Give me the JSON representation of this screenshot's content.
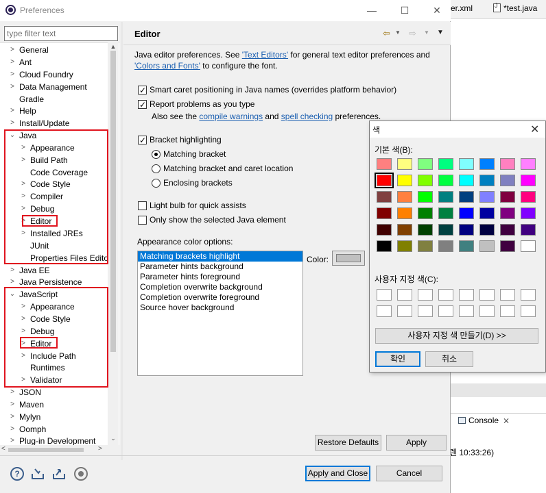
{
  "ide": {
    "tab_xml": "er.xml",
    "tab_java": "*test.java",
    "console_tab": "Console",
    "console_close": "⨯",
    "console_time": "렌 10:33:26)"
  },
  "window": {
    "title": "Preferences",
    "minimize": "—",
    "maximize": "☐",
    "close": "✕"
  },
  "filter": {
    "placeholder": "type filter text"
  },
  "tree": {
    "general": "General",
    "ant": "Ant",
    "cloud_foundry": "Cloud Foundry",
    "data_management": "Data Management",
    "gradle": "Gradle",
    "help": "Help",
    "install_update": "Install/Update",
    "java": "Java",
    "java_appearance": "Appearance",
    "java_build_path": "Build Path",
    "java_code_coverage": "Code Coverage",
    "java_code_style": "Code Style",
    "java_compiler": "Compiler",
    "java_debug": "Debug",
    "java_editor": "Editor",
    "java_installed_jres": "Installed JREs",
    "java_junit": "JUnit",
    "java_properties_files_editor": "Properties Files Edito",
    "java_ee": "Java EE",
    "java_persistence": "Java Persistence",
    "javascript": "JavaScript",
    "js_appearance": "Appearance",
    "js_code_style": "Code Style",
    "js_debug": "Debug",
    "js_editor": "Editor",
    "js_include_path": "Include Path",
    "js_runtimes": "Runtimes",
    "js_validator": "Validator",
    "json": "JSON",
    "maven": "Maven",
    "mylyn": "Mylyn",
    "oomph": "Oomph",
    "plugin_development": "Plug-in Development"
  },
  "editor": {
    "title": "Editor",
    "intro_1": "Java editor preferences. See ",
    "intro_link1": "'Text Editors'",
    "intro_2": " for general text editor preferences and ",
    "intro_link2": "'Colors and Fonts'",
    "intro_3": " to configure the font.",
    "smart_caret": "Smart caret positioning in Java names (overrides platform behavior)",
    "report_problems": "Report problems as you type",
    "see_also_1": "Also see the ",
    "see_also_link1": "compile warnings",
    "see_also_2": " and ",
    "see_also_link2": "spell checking",
    "see_also_3": " preferences.",
    "bracket_highlighting": "Bracket highlighting",
    "matching_bracket": "Matching bracket",
    "matching_bracket_caret": "Matching bracket and caret location",
    "enclosing_brackets": "Enclosing brackets",
    "light_bulb": "Light bulb for quick assists",
    "only_selected": "Only show the selected Java element",
    "appearance_options_label": "Appearance color options:",
    "color_options": [
      "Matching brackets highlight",
      "Parameter hints background",
      "Parameter hints foreground",
      "Completion overwrite background",
      "Completion overwrite foreground",
      "Source hover background"
    ],
    "color_label": "Color:",
    "color_value": "#c0c0c0"
  },
  "buttons": {
    "restore_defaults": "Restore Defaults",
    "apply": "Apply",
    "apply_and_close": "Apply and Close",
    "cancel": "Cancel",
    "help_symbol": "?"
  },
  "color_dialog": {
    "title": "색",
    "close": "✕",
    "basic_colors_label": "기본 색(B):",
    "custom_colors_label": "사용자 지정 색(C):",
    "define_custom": "사용자 지정 색 만들기(D) >>",
    "ok": "확인",
    "cancel": "취소",
    "basic_colors": [
      [
        "#ff8080",
        "#ffff80",
        "#80ff80",
        "#00ff80",
        "#80ffff",
        "#0080ff",
        "#ff80c0",
        "#ff80ff"
      ],
      [
        "#ff0000",
        "#ffff00",
        "#80ff00",
        "#00ff40",
        "#00ffff",
        "#0080c0",
        "#8080c0",
        "#ff00ff"
      ],
      [
        "#804040",
        "#ff8040",
        "#00ff00",
        "#008080",
        "#004080",
        "#8080ff",
        "#800040",
        "#ff0080"
      ],
      [
        "#800000",
        "#ff8000",
        "#008000",
        "#008040",
        "#0000ff",
        "#0000a0",
        "#800080",
        "#8000ff"
      ],
      [
        "#400000",
        "#804000",
        "#004000",
        "#004040",
        "#000080",
        "#000040",
        "#400040",
        "#400080"
      ],
      [
        "#000000",
        "#808000",
        "#808040",
        "#808080",
        "#408080",
        "#c0c0c0",
        "#400040",
        "#ffffff"
      ]
    ],
    "selected_color": "#ff0000"
  }
}
